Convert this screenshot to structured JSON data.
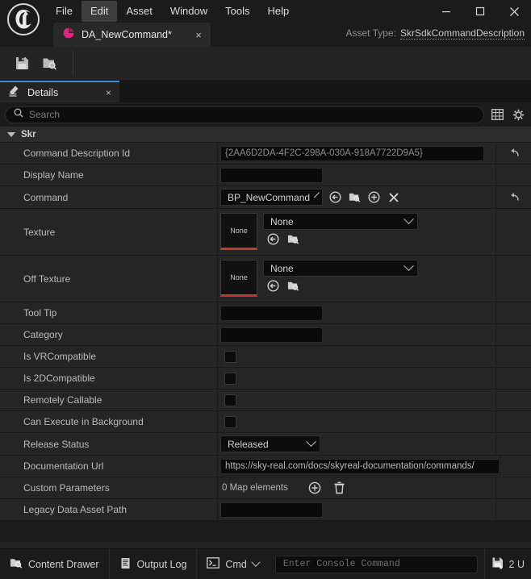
{
  "window": {
    "logo_icon": "unreal-engine-logo",
    "menus": [
      {
        "label": "File",
        "active": false
      },
      {
        "label": "Edit",
        "active": true
      },
      {
        "label": "Asset",
        "active": false
      },
      {
        "label": "Window",
        "active": false
      },
      {
        "label": "Tools",
        "active": false
      },
      {
        "label": "Help",
        "active": false
      }
    ],
    "controls": {
      "minimize": "minimize-icon",
      "maximize": "maximize-icon",
      "close": "close-icon"
    }
  },
  "asset_tab": {
    "icon": "data-asset-icon",
    "label": "DA_NewCommand*",
    "close": "×",
    "asset_type_label": "Asset Type:",
    "asset_type_value": "SkrSdkCommandDescription"
  },
  "toolbar": {
    "save_icon": "save-icon",
    "browse_icon": "browse-content-icon"
  },
  "details_panel": {
    "tab_label": "Details",
    "tab_icon": "details-icon",
    "tab_close": "×",
    "search_placeholder": "Search",
    "search_icon": "search-icon",
    "column_icon": "column-settings-icon",
    "settings_icon": "gear-icon"
  },
  "category": {
    "name": "Skr",
    "expanded": true
  },
  "properties": [
    {
      "label": "Command Description Id",
      "type": "text",
      "value": "{2AA6D2DA-4F2C-298A-030A-918A7722D9A5}",
      "width": "wide",
      "reset": true
    },
    {
      "label": "Display Name",
      "type": "text",
      "value": "",
      "width": "mid",
      "reset": false
    },
    {
      "label": "Command",
      "type": "object",
      "value": "BP_NewCommand",
      "icons": [
        "use-selected-icon",
        "browse-icon",
        "new-asset-icon",
        "clear-icon"
      ],
      "reset": true
    },
    {
      "label": "Texture",
      "type": "asset",
      "thumb_label": "None",
      "value": "None",
      "icons": [
        "use-selected-icon",
        "browse-icon"
      ],
      "reset": false
    },
    {
      "label": "Off Texture",
      "type": "asset",
      "thumb_label": "None",
      "value": "None",
      "icons": [
        "use-selected-icon",
        "browse-icon"
      ],
      "reset": false
    },
    {
      "label": "Tool Tip",
      "type": "text",
      "value": "",
      "width": "mid",
      "reset": false
    },
    {
      "label": "Category",
      "type": "text",
      "value": "",
      "width": "mid",
      "reset": false
    },
    {
      "label": "Is VRCompatible",
      "type": "checkbox",
      "checked": false,
      "reset": false
    },
    {
      "label": "Is 2DCompatible",
      "type": "checkbox",
      "checked": false,
      "reset": false
    },
    {
      "label": "Remotely Callable",
      "type": "checkbox",
      "checked": false,
      "reset": false
    },
    {
      "label": "Can Execute in Background",
      "type": "checkbox",
      "checked": false,
      "reset": false
    },
    {
      "label": "Release Status",
      "type": "combo",
      "value": "Released",
      "reset": false
    },
    {
      "label": "Documentation Url",
      "type": "text",
      "value": "https://sky-real.com/docs/skyreal-documentation/commands/",
      "width": "url",
      "reset": false
    },
    {
      "label": "Custom Parameters",
      "type": "map",
      "value": "0 Map elements",
      "icons": [
        "add-element-icon",
        "delete-all-icon"
      ],
      "reset": false
    },
    {
      "label": "Legacy Data Asset Path",
      "type": "text",
      "value": "",
      "width": "mid",
      "reset": false
    }
  ],
  "status_bar": {
    "content_drawer": "Content Drawer",
    "content_drawer_icon": "content-drawer-icon",
    "output_log": "Output Log",
    "output_log_icon": "output-log-icon",
    "cmd_label": "Cmd",
    "cmd_icon": "console-icon",
    "console_placeholder": "Enter Console Command",
    "unsaved_label": "2 U",
    "unsaved_icon": "unsaved-assets-icon"
  },
  "colors": {
    "accent_tab": "#3b8fd4",
    "asset_icon": "#e5207e",
    "thumb_border": "#c0392b",
    "panel_bg": "#212121",
    "row_bg": "#252525"
  }
}
